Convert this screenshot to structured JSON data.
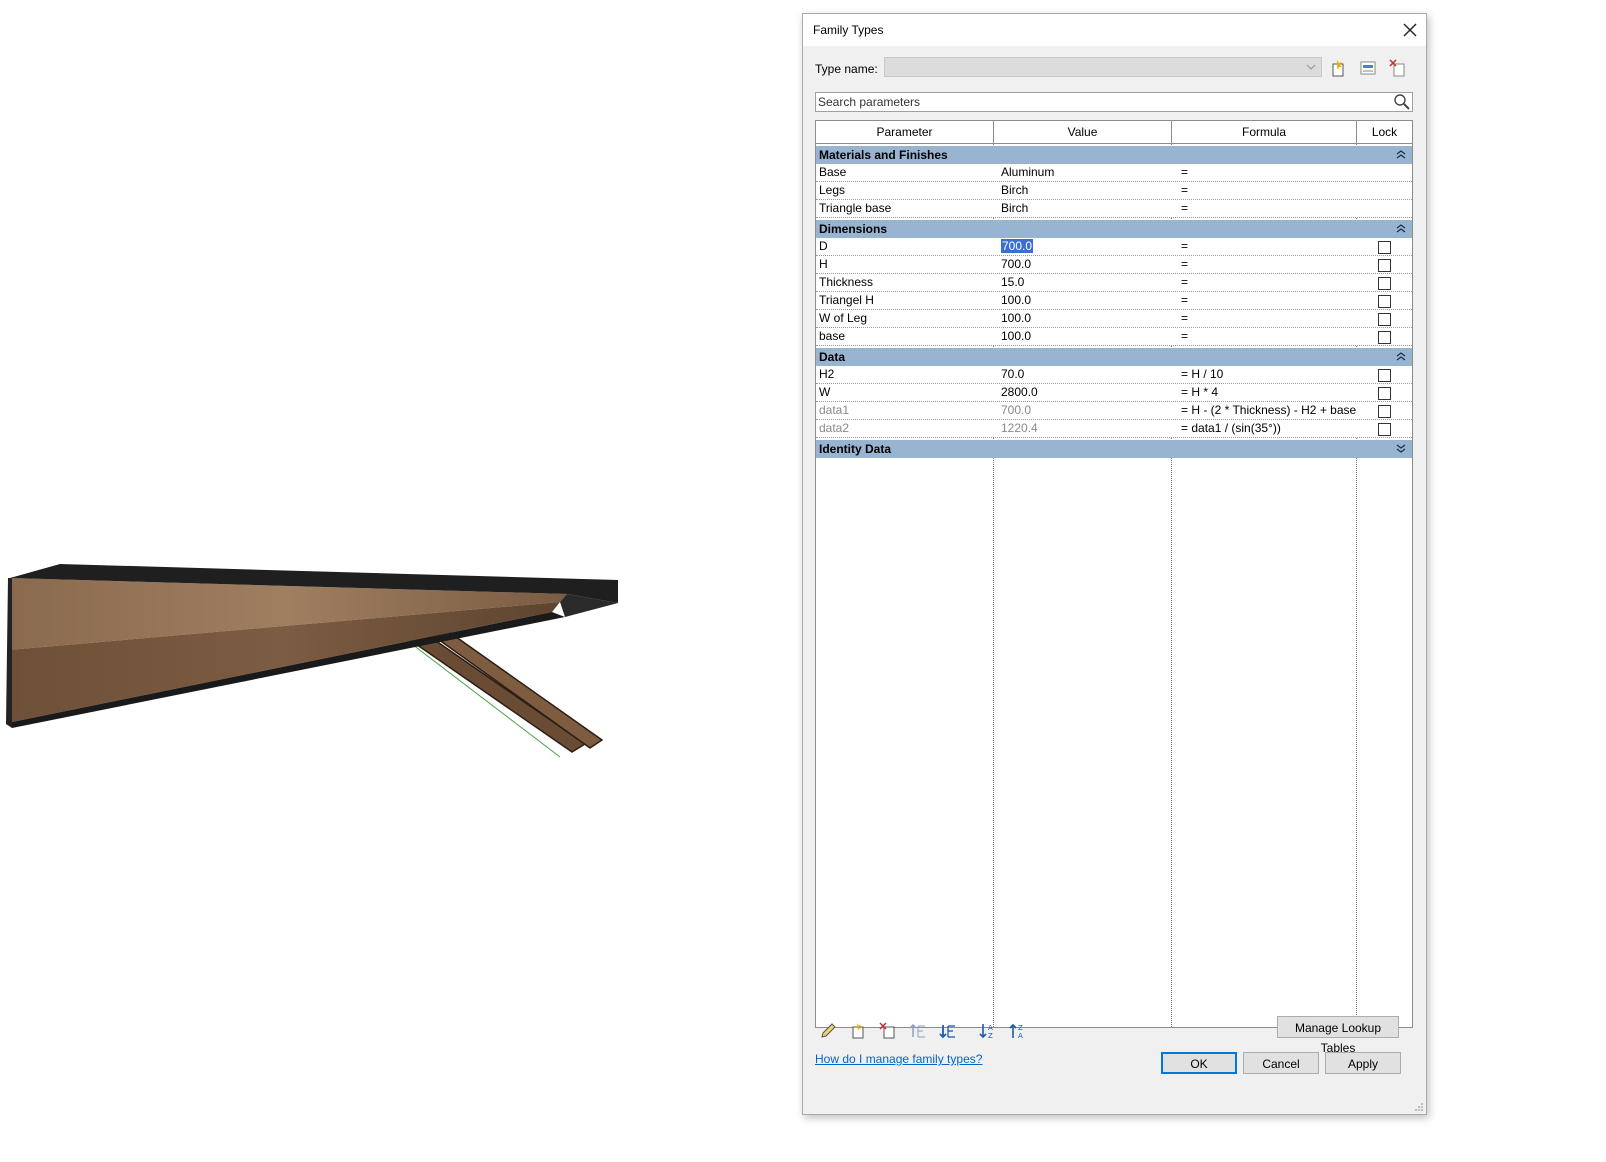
{
  "dialog": {
    "title": "Family Types",
    "type_name_label": "Type name:",
    "type_name_value": "",
    "search_placeholder": "Search parameters"
  },
  "grid": {
    "headers": [
      "Parameter",
      "Value",
      "Formula",
      "Lock"
    ],
    "groups": [
      {
        "name": "Materials and Finishes",
        "rows": [
          {
            "param": "Base",
            "value": "Aluminum",
            "formula": "="
          },
          {
            "param": "Legs",
            "value": "Birch",
            "formula": "="
          },
          {
            "param": "Triangle base",
            "value": "Birch",
            "formula": "="
          }
        ]
      },
      {
        "name": "Dimensions",
        "rows": [
          {
            "param": "D",
            "value": "700.0",
            "formula": "="
          },
          {
            "param": "H",
            "value": "700.0",
            "formula": "="
          },
          {
            "param": "Thickness",
            "value": "15.0",
            "formula": "="
          },
          {
            "param": "Triangel H",
            "value": "100.0",
            "formula": "="
          },
          {
            "param": "W of Leg",
            "value": "100.0",
            "formula": "="
          },
          {
            "param": "base",
            "value": "100.0",
            "formula": "="
          }
        ]
      },
      {
        "name": "Data",
        "rows": [
          {
            "param": "H2",
            "value": "70.0",
            "formula": "= H / 10"
          },
          {
            "param": "W",
            "value": "2800.0",
            "formula": "= H * 4"
          },
          {
            "param": "data1",
            "value": "700.0",
            "formula": "= H - (2 * Thickness) - H2 + base"
          },
          {
            "param": "data2",
            "value": "1220.4",
            "formula": "= data1 / (sin(35°))"
          }
        ]
      },
      {
        "name": "Identity Data",
        "rows": []
      }
    ]
  },
  "buttons": {
    "manage_lookup": "Manage Lookup Tables",
    "ok": "OK",
    "cancel": "Cancel",
    "apply": "Apply"
  },
  "help_link": "How do I manage family types?",
  "colors": {
    "group_header": "#99b4d1",
    "selection": "#3a6fd1",
    "link": "#0066cc"
  },
  "icons": [
    "close-icon",
    "new-type-icon",
    "rename-type-icon",
    "delete-type-icon",
    "search-icon",
    "edit-parameter-icon",
    "new-parameter-icon",
    "delete-parameter-icon",
    "move-up-icon",
    "move-down-icon",
    "sort-ascending-icon",
    "sort-descending-icon",
    "collapse-icon",
    "expand-icon"
  ]
}
